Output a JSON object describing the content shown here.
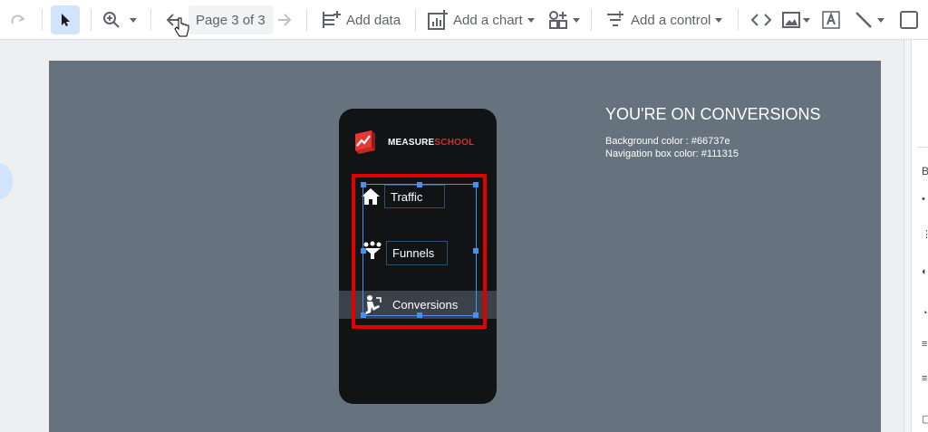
{
  "toolbar": {
    "page_indicator": "Page 3 of 3",
    "add_data": "Add data",
    "add_chart": "Add a chart",
    "add_control": "Add a control"
  },
  "canvas": {
    "background_color": "#66737e",
    "heading": "YOU'RE ON CONVERSIONS",
    "info_lines": [
      "Background color : #66737e",
      "Navigation box color: #111315"
    ]
  },
  "phone": {
    "bg_color": "#111315",
    "logo": {
      "part1": "MEASURE",
      "part2": "SCHOOL"
    },
    "nav_items": [
      {
        "label": "Traffic",
        "icon": "house-icon"
      },
      {
        "label": "Funnels",
        "icon": "funnel-icon"
      },
      {
        "label": "Conversions",
        "icon": "conversion-icon"
      }
    ],
    "active_index": 2
  },
  "colors": {
    "selection": "#4a8ff0",
    "highlight_border": "#e00000",
    "active_row": "#3a414a"
  }
}
